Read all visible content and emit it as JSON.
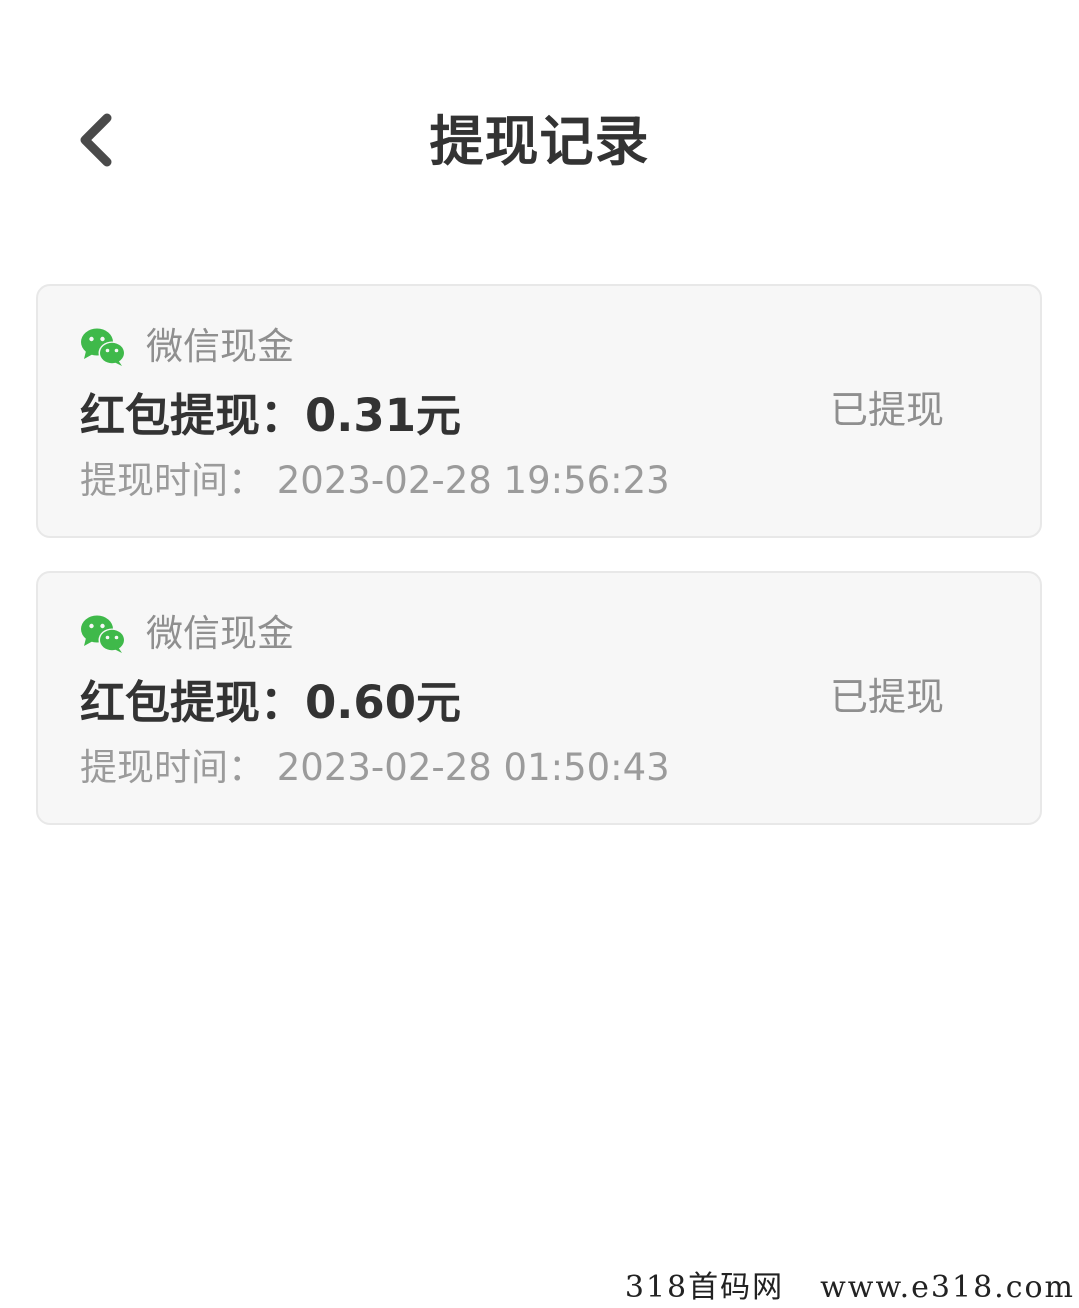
{
  "header": {
    "title": "提现记录",
    "back_icon": "chevron-left-icon"
  },
  "records": [
    {
      "source_icon": "wechat-icon",
      "source": "微信现金",
      "amount": "红包提现：0.31元",
      "time": "提现时间：  2023-02-28 19:56:23",
      "status": "已提现"
    },
    {
      "source_icon": "wechat-icon",
      "source": "微信现金",
      "amount": "红包提现：0.60元",
      "time": "提现时间：  2023-02-28 01:50:43",
      "status": "已提现"
    }
  ],
  "watermark": {
    "brand": "318首码网",
    "url": "www.e318.com"
  },
  "colors": {
    "wechat_green": "#3fb94a",
    "card_background": "#f7f7f7",
    "text_dark": "#333333",
    "text_muted": "#8f8f8f"
  }
}
